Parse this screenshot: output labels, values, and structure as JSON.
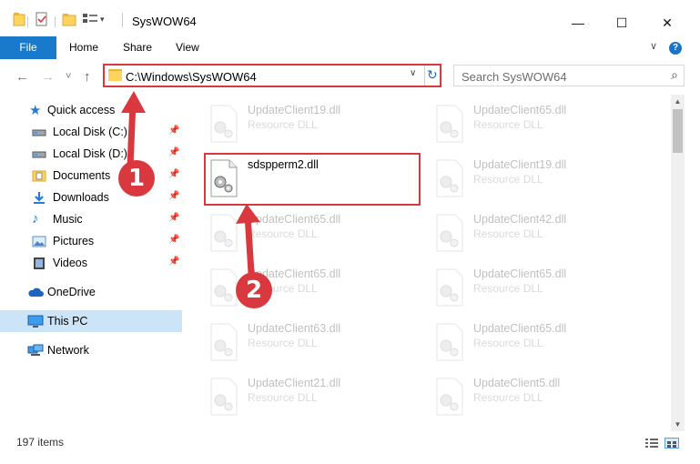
{
  "window": {
    "title": "SysWOW64",
    "minimize_glyph": "—",
    "maximize_glyph": "☐",
    "close_glyph": "✕"
  },
  "ribbon": {
    "tabs": [
      "File",
      "Home",
      "Share",
      "View"
    ],
    "collapse_glyph": "∨",
    "help_glyph": "?"
  },
  "nav": {
    "back_glyph": "←",
    "forward_glyph": "→",
    "recent_glyph": "˅",
    "up_glyph": "↑",
    "address": "C:\\Windows\\SysWOW64",
    "address_dropdown_glyph": "∨",
    "refresh_glyph": "↻",
    "search_placeholder": "Search SysWOW64",
    "search_glyph": "⌕"
  },
  "sidebar": {
    "items": [
      {
        "label": "Quick access",
        "icon": "star-icon"
      },
      {
        "label": "Local Disk (C:)",
        "icon": "drive-icon",
        "pinned": true
      },
      {
        "label": "Local Disk (D:)",
        "icon": "drive-icon",
        "pinned": true
      },
      {
        "label": "Documents",
        "icon": "documents-icon",
        "pinned": true
      },
      {
        "label": "Downloads",
        "icon": "downloads-icon",
        "pinned": true
      },
      {
        "label": "Music",
        "icon": "music-icon",
        "pinned": true
      },
      {
        "label": "Pictures",
        "icon": "pictures-icon",
        "pinned": true
      },
      {
        "label": "Videos",
        "icon": "videos-icon",
        "pinned": true
      },
      {
        "label": "OneDrive",
        "icon": "cloud-icon"
      },
      {
        "label": "This PC",
        "icon": "computer-icon",
        "selected": true
      },
      {
        "label": "Network",
        "icon": "network-icon"
      }
    ],
    "pin_glyph": "📌"
  },
  "files": [
    {
      "name": "UpdateClient19.dll",
      "type": "Resource DLL",
      "faded": true
    },
    {
      "name": "UpdateClient65.dll",
      "type": "Resource DLL",
      "faded": true
    },
    {
      "name": "sdspperm2.dll",
      "type": "",
      "faded": false
    },
    {
      "name": "UpdateClient19.dll",
      "type": "Resource DLL",
      "faded": true
    },
    {
      "name": "UpdateClient65.dll",
      "type": "Resource DLL",
      "faded": true
    },
    {
      "name": "UpdateClient42.dll",
      "type": "Resource DLL",
      "faded": true
    },
    {
      "name": "UpdateClient65.dll",
      "type": "Resource DLL",
      "faded": true
    },
    {
      "name": "UpdateClient65.dll",
      "type": "Resource DLL",
      "faded": true
    },
    {
      "name": "UpdateClient63.dll",
      "type": "Resource DLL",
      "faded": true
    },
    {
      "name": "UpdateClient65.dll",
      "type": "Resource DLL",
      "faded": true
    },
    {
      "name": "UpdateClient21.dll",
      "type": "Resource DLL",
      "faded": true
    },
    {
      "name": "UpdateClient5.dll",
      "type": "Resource DLL",
      "faded": true
    }
  ],
  "status": {
    "count": "197 items"
  },
  "annotations": {
    "step1": "1",
    "step2": "2",
    "color": "#d9393e"
  },
  "scroll": {
    "up_glyph": "▲",
    "down_glyph": "▼"
  }
}
